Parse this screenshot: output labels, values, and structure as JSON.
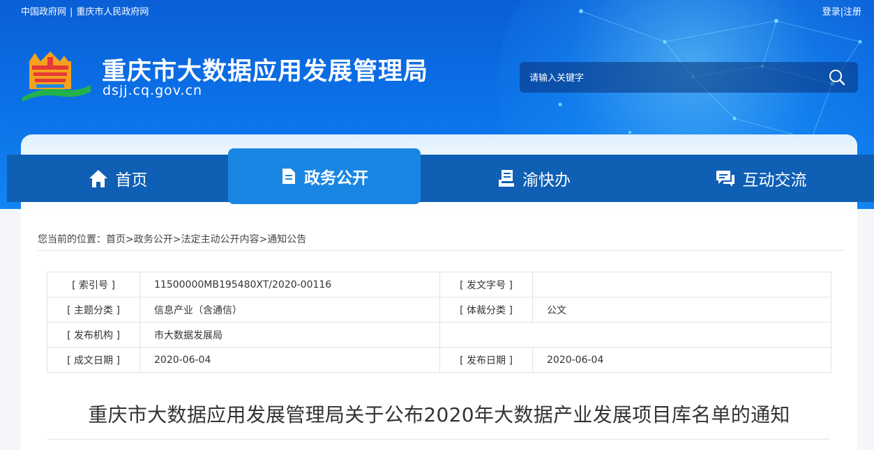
{
  "topbar": {
    "link1": "中国政府网",
    "separator": "|",
    "link2": "重庆市人民政府网",
    "login": "登录",
    "divider": "|",
    "register": "注册"
  },
  "header": {
    "title": "重庆市大数据应用发展管理局",
    "domain": "dsjj.cq.gov.cn",
    "logo_icon": "building-emblem-icon"
  },
  "search": {
    "placeholder": "请输入关键字",
    "icon": "search-icon"
  },
  "nav": {
    "items": [
      {
        "label": "首页",
        "icon": "home-icon"
      },
      {
        "label": "政务公开",
        "icon": "document-icon",
        "active": true
      },
      {
        "label": "渝快办",
        "icon": "stack-icon"
      },
      {
        "label": "互动交流",
        "icon": "chat-icon"
      }
    ]
  },
  "breadcrumb": {
    "prefix": "您当前的位置：",
    "items": [
      "首页",
      "政务公开",
      "法定主动公开内容",
      "通知公告"
    ],
    "separator": ">"
  },
  "meta": {
    "index_label": "[ 索引号 ]",
    "index_value": "11500000MB195480XT/2020-00116",
    "docno_label": "[ 发文字号 ]",
    "docno_value": "",
    "topic_label": "[ 主题分类 ]",
    "topic_value": "信息产业（含通信）",
    "genre_label": "[ 体裁分类 ]",
    "genre_value": "公文",
    "issuer_label": "[ 发布机构 ]",
    "issuer_value": "市大数据发展局",
    "created_label": "[ 成文日期 ]",
    "created_value": "2020-06-04",
    "published_label": "[ 发布日期 ]",
    "published_value": "2020-06-04"
  },
  "document": {
    "title": "重庆市大数据应用发展管理局关于公布2020年大数据产业发展项目库名单的通知"
  },
  "colors": {
    "banner_blue": "#0b6fe6",
    "nav_blue": "#0f5fb5",
    "nav_active": "#1a86e3"
  }
}
